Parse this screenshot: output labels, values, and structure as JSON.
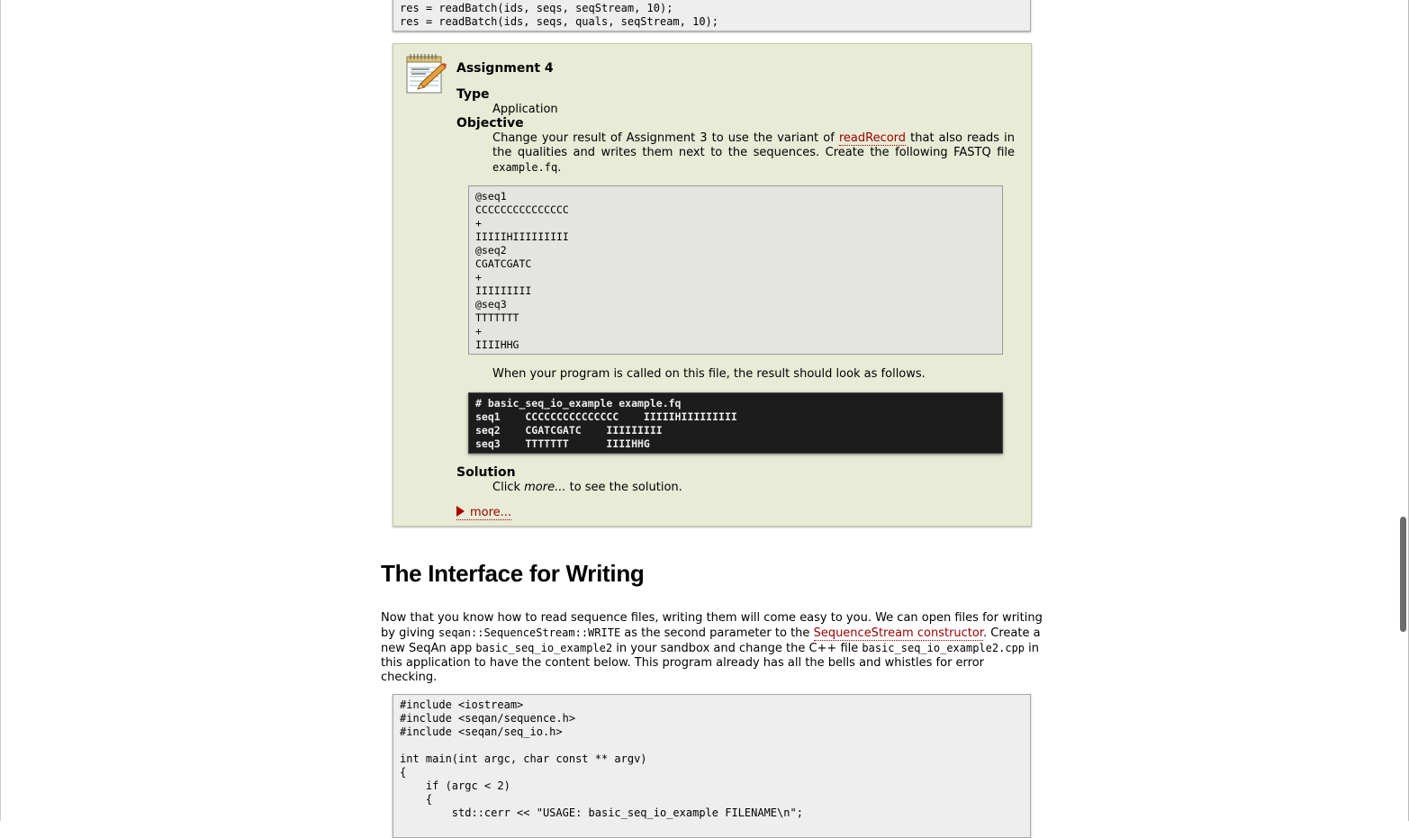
{
  "top_code": {
    "lines": "res = readBatch(ids, seqs, seqStream, 10);\nres = readBatch(ids, seqs, quals, seqStream, 10);"
  },
  "assignment": {
    "title": "Assignment 4",
    "type_term": "Type",
    "type_value": "Application",
    "objective_term": "Objective",
    "objective_pre": "Change your result of Assignment 3 to use the variant of ",
    "objective_link": "readRecord",
    "objective_mid": " that also reads in the qualities and writes them next to the sequences. Create the following FASTQ file ",
    "objective_file": "example.fq",
    "objective_end": ".",
    "fastq_content": "@seq1\nCCCCCCCCCCCCCCC\n+\nIIIIIHIIIIIIIII\n@seq2\nCGATCGATC\n+\nIIIIIIIII\n@seq3\nTTTTTTT\n+\nIIIIHHG",
    "result_text": "When your program is called on this file, the result should look as follows.",
    "console_output": "# basic_seq_io_example example.fq\nseq1    CCCCCCCCCCCCCCC    IIIIIHIIIIIIIII\nseq2    CGATCGATC    IIIIIIIII\nseq3    TTTTTTT      IIIIHHG",
    "solution_term": "Solution",
    "solution_pre": "Click ",
    "solution_em": "more...",
    "solution_post": " to see the solution.",
    "more_label": "more..."
  },
  "section": {
    "heading": "The Interface for Writing",
    "p1": "Now that you know how to read sequence files, writing them will come easy to you. We can open files for writing by giving ",
    "code1": "seqan::SequenceStream::WRITE",
    "p2": " as the second parameter to the ",
    "link1": "SequenceStream constructor",
    "p3": ". Create a new SeqAn app ",
    "code2": "basic_seq_io_example2",
    "p4": " in your sandbox and change the C++ file ",
    "code3": "basic_seq_io_example2.cpp",
    "p5": " in this application to have the content below. This program already has all the bells and whistles for error checking."
  },
  "bottom_code": {
    "lines": "#include <iostream>\n#include <seqan/sequence.h>\n#include <seqan/seq_io.h>\n\nint main(int argc, char const ** argv)\n{\n    if (argc < 2)\n    {\n        std::cerr << \"USAGE: basic_seq_io_example FILENAME\\n\";"
  },
  "icons": {
    "assignment": "notepad-pencil-icon",
    "expand": "triangle-right-icon"
  }
}
